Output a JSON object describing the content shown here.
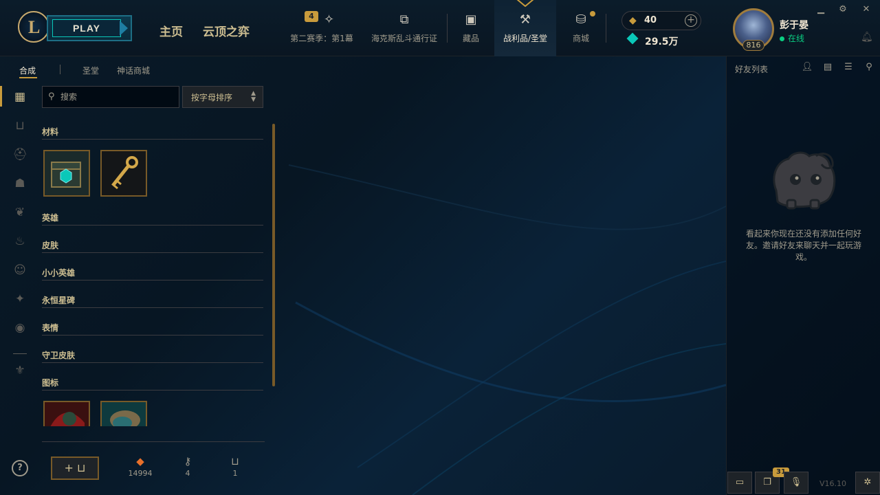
{
  "topbar": {
    "logo_letter": "L",
    "play_label": "PLAY",
    "nav_home": "主页",
    "nav_tft": "云顶之弈",
    "season_badge": "4",
    "season_label": "第二赛季：第1幕",
    "pass_label": "海克斯乱斗通行证",
    "collection_label": "藏品",
    "loot_label": "战利品/圣堂",
    "store_label": "商城",
    "rp_value": "40",
    "be_value": "29.5万",
    "level": "816",
    "username": "彭于晏",
    "status": "在线"
  },
  "subtabs": {
    "craft": "合成",
    "sanctum": "圣堂",
    "mythic_shop": "神话商城"
  },
  "search": {
    "placeholder": "搜索"
  },
  "sort": {
    "label": "按字母排序"
  },
  "sections": {
    "materials": "材料",
    "champions": "英雄",
    "skins": "皮肤",
    "tft_little_legends": "小小英雄",
    "eternals": "永恒星碑",
    "emotes": "表情",
    "ward_skins": "守卫皮肤",
    "icons": "图标"
  },
  "counters": {
    "orange_essence": "14994",
    "keys": "4",
    "chests": "1"
  },
  "friends": {
    "title": "好友列表",
    "empty_message": "看起来你现在还没有添加任何好友。邀请好友来聊天并一起玩游戏。",
    "chat_badge": "31",
    "version": "V16.10"
  },
  "colors": {
    "gold": "#c89b3c",
    "gold_light": "#cdbe91",
    "teal": "#0ac8b9",
    "online_green": "#0acf83"
  }
}
